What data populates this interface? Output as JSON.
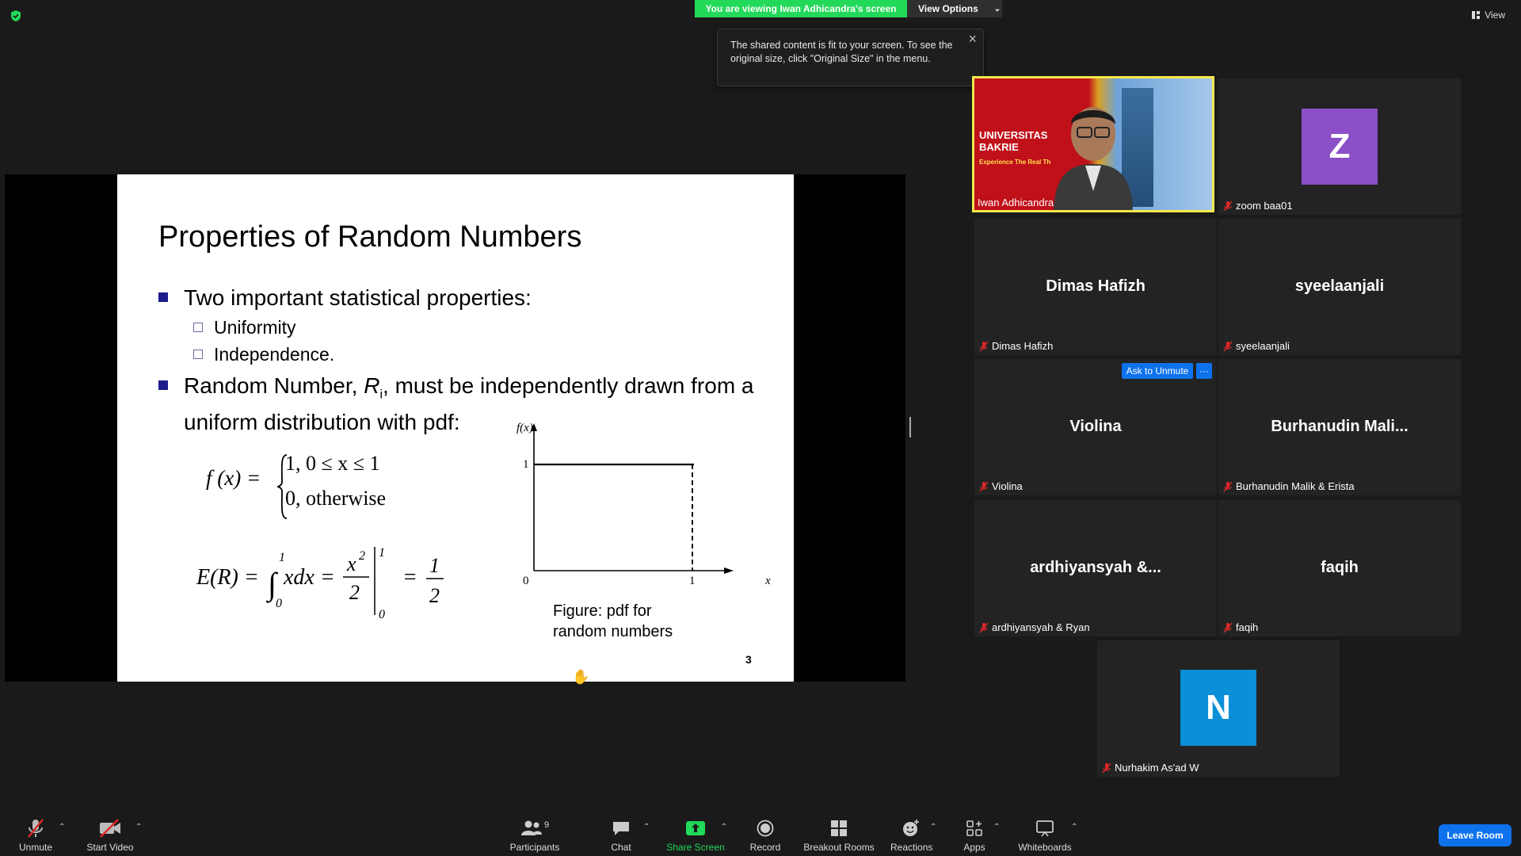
{
  "top": {
    "viewing_banner": "You are viewing Iwan Adhicandra's screen",
    "view_options": "View Options",
    "view_label": "View",
    "tooltip": "The shared content is fit to your screen. To see the original size, click \"Original Size\" in the menu."
  },
  "slide": {
    "title": "Properties of Random Numbers",
    "bullet1": "Two important statistical properties:",
    "sub1": "Uniformity",
    "sub2": "Independence.",
    "bullet2_line1_pre": "Random Number, ",
    "bullet2_var": "R",
    "bullet2_sub": "i",
    "bullet2_line1_post": ", must be independently drawn from a",
    "bullet2_line2": "uniform distribution with pdf:",
    "fig_caption_1": "Figure: pdf for",
    "fig_caption_2": "random numbers",
    "page_number": "3",
    "graph": {
      "y_axis_label": "f(x)",
      "x_axis_label": "x",
      "tick_y_1": "1",
      "tick_origin": "0",
      "tick_x_1": "1"
    },
    "formula_f": "f (x) =",
    "formula_case1": "1,   0 ≤ x ≤ 1",
    "formula_case2": "0,   otherwise",
    "formula_e": "E(R) = ∫ xdx = x² / 2 | = 1/2"
  },
  "participants": [
    {
      "name": "Iwan Adhicandra",
      "display": "",
      "type": "video"
    },
    {
      "name": "zoom baa01",
      "display": "Z",
      "type": "avatar",
      "color": "#8b4fc7"
    },
    {
      "name": "Dimas Hafizh",
      "display": "Dimas Hafizh",
      "type": "name"
    },
    {
      "name": "syeelaanjali",
      "display": "syeelaanjali",
      "type": "name"
    },
    {
      "name": "Violina",
      "display": "Violina",
      "type": "name"
    },
    {
      "name": "Burhanudin Malik & Erista",
      "display": "Burhanudin  Mali...",
      "type": "name"
    },
    {
      "name": "ardhiyansyah & Ryan",
      "display": "ardhiyansyah  &...",
      "type": "name"
    },
    {
      "name": "faqih",
      "display": "faqih",
      "type": "name"
    },
    {
      "name": "Nurhakim As'ad W",
      "display": "N",
      "type": "avatar",
      "color": "#0b8fd6"
    }
  ],
  "video_banner": {
    "line1": "UNIVERSITAS",
    "line2": "BAKRIE",
    "line3": "Experience The Real Th"
  },
  "ask_to_unmute": "Ask to Unmute",
  "more": "···",
  "toolbar": {
    "unmute": "Unmute",
    "start_video": "Start Video",
    "participants": "Participants",
    "participants_count": "9",
    "chat": "Chat",
    "share_screen": "Share Screen",
    "record": "Record",
    "breakout_rooms": "Breakout Rooms",
    "reactions": "Reactions",
    "apps": "Apps",
    "whiteboards": "Whiteboards",
    "leave_room": "Leave Room"
  },
  "colors": {
    "accent_blue": "#0e72ed",
    "share_green": "#23d959",
    "active_speaker": "#f5e74a",
    "muted_red": "#e02828"
  }
}
